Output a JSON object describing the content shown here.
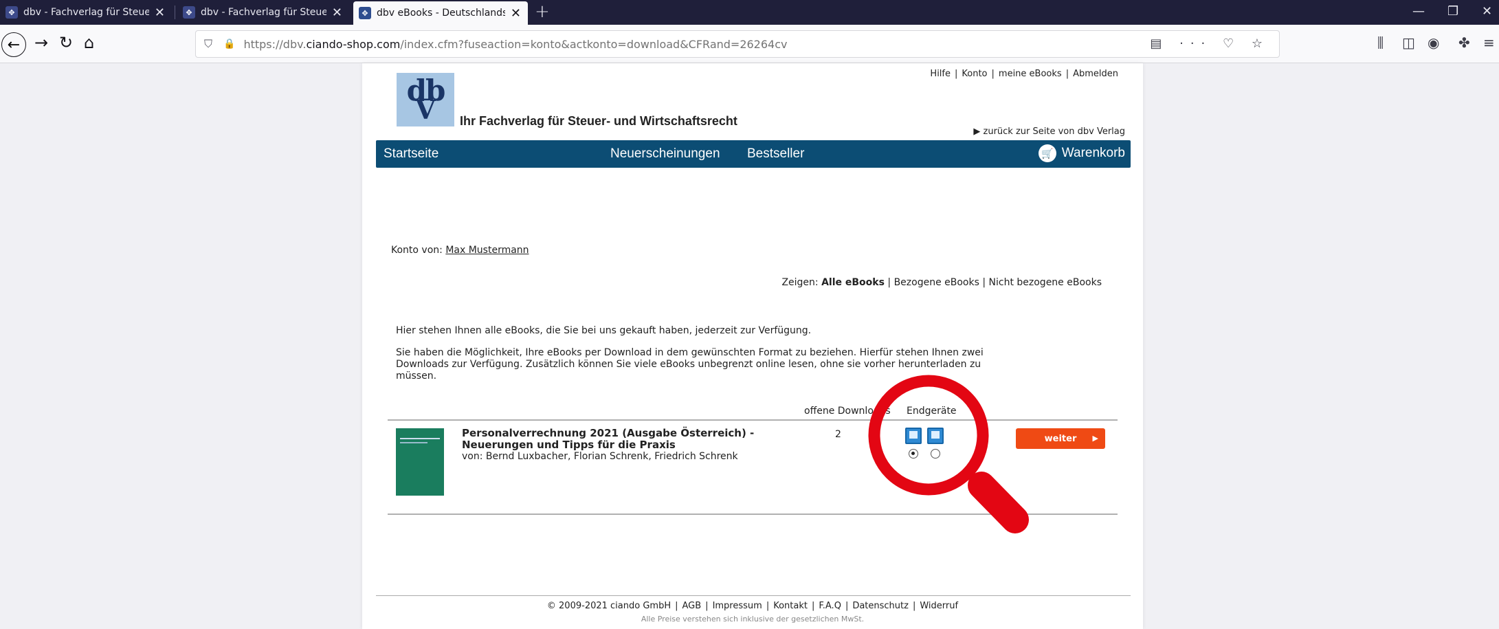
{
  "browser": {
    "tabs": [
      {
        "title": "dbv - Fachverlag für Steuer- und",
        "favicon": "dbv-favicon"
      },
      {
        "title": "dbv - Fachverlag für Steuer- und",
        "favicon": "dbv-favicon"
      },
      {
        "title": "dbv eBooks - Deutschlands größ",
        "favicon": "dbv-favicon"
      }
    ],
    "url": {
      "prefix": "https://dbv.",
      "domain": "ciando-shop.com",
      "path": "/index.cfm?fuseaction=konto&actkonto=download&CFRand=26264cv"
    }
  },
  "header": {
    "links": [
      "Hilfe",
      "Konto",
      "meine eBooks",
      "Abmelden"
    ],
    "logo": {
      "line1": "db",
      "line2": "V"
    },
    "tagline": "Ihr Fachverlag für Steuer- und Wirtschaftsrecht",
    "back_link": "▶ zurück zur Seite von dbv Verlag"
  },
  "nav": {
    "start": "Startseite",
    "new": "Neuerscheinungen",
    "best": "Bestseller",
    "cart": "Warenkorb"
  },
  "account": {
    "label": "Konto von:",
    "name": "Max Mustermann"
  },
  "filter": {
    "label": "Zeigen:",
    "all": "Alle eBooks",
    "obtained": "Bezogene eBooks",
    "not_obtained": "Nicht bezogene eBooks"
  },
  "intro": {
    "line1": "Hier stehen Ihnen alle eBooks, die Sie bei uns gekauft haben, jederzeit zur Verfügung.",
    "line2": "Sie haben die Möglichkeit, Ihre eBooks per Download in dem gewünschten Format zu beziehen. Hierfür stehen Ihnen zwei Downloads zur Verfügung. Zusätzlich können Sie viele eBooks unbegrenzt online lesen, ohne sie vorher herunterladen zu müssen."
  },
  "table": {
    "col_downloads": "offene Downloads",
    "col_devices": "Endgeräte",
    "row": {
      "title": "Personalverrechnung 2021 (Ausgabe Österreich) - Neuerungen und Tipps für die Praxis",
      "authors": "von: Bernd Luxbacher, Florian Schrenk, Friedrich Schrenk",
      "open_downloads": "2",
      "button": "weiter",
      "device_selected": "computer"
    }
  },
  "footer": {
    "links": [
      "© 2009-2021 ciando GmbH",
      "AGB",
      "Impressum",
      "Kontakt",
      "F.A.Q",
      "Datenschutz",
      "Widerruf"
    ],
    "note": "Alle Preise verstehen sich inklusive der gesetzlichen MwSt."
  },
  "colors": {
    "nav_bg": "#0c4d74",
    "button_bg": "#ef4a14",
    "magnifier": "#e30613",
    "tabbar": "#1f1f3a"
  }
}
